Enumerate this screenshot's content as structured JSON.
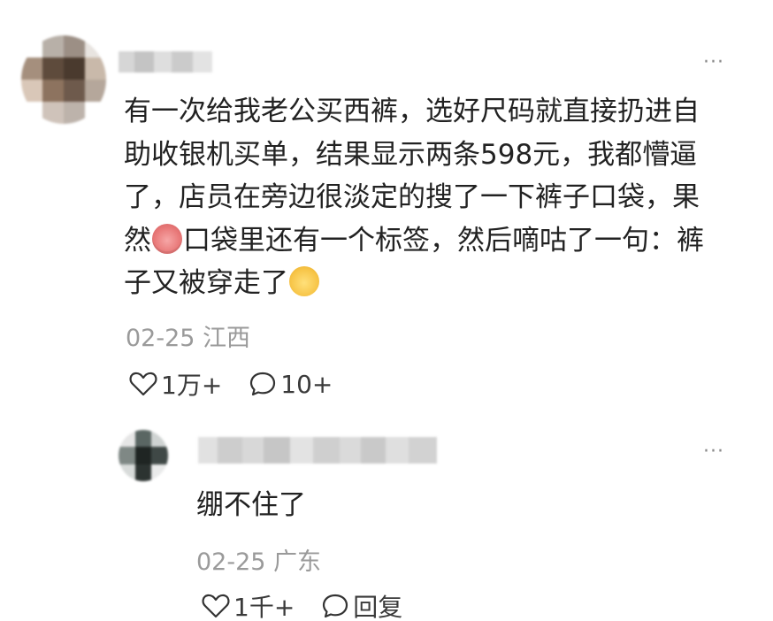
{
  "comment": {
    "avatar": "pixelated-avatar",
    "username": "",
    "more_icon": "···",
    "text_lines": [
      "有一次给我老公买西裤，选好尺码就直接扔进自",
      "助收银机买单，结果显示两条598元，我都懵逼",
      "了，店员在旁边很淡定的搜了一下裤子口袋，果",
      "然",
      "口袋里还有一个标签，然后嘀咕了一句：裤",
      "子又被穿走了"
    ],
    "emojis": [
      "crying-face-emoji",
      "laughing-face-emoji"
    ],
    "date": "02-25",
    "location": "江西",
    "like_count": "1万+",
    "reply_count": "10+"
  },
  "reply": {
    "avatar": "pixelated-avatar",
    "username": "",
    "more_icon": "···",
    "text": "绷不住了",
    "date": "02-25",
    "location": "广东",
    "like_count": "1千+",
    "reply_label": "回复"
  }
}
